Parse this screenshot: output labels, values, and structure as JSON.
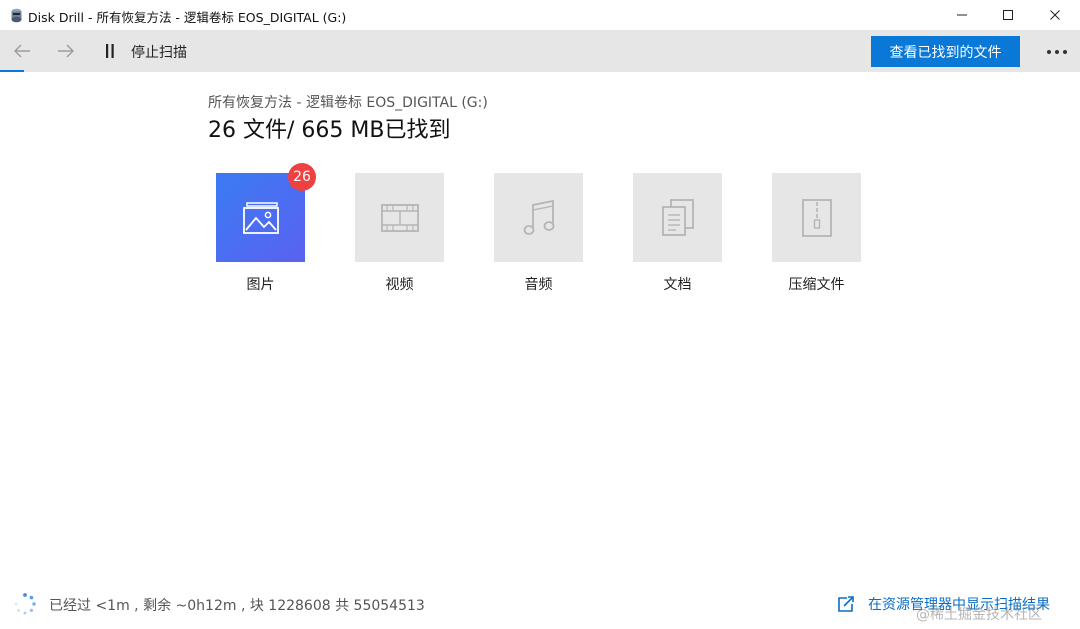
{
  "window": {
    "title": "Disk Drill - 所有恢复方法 - 逻辑卷标 EOS_DIGITAL (G:)",
    "controls": [
      "minimize-icon",
      "maximize-icon",
      "close-icon"
    ]
  },
  "toolbar": {
    "back_icon": "arrow-left-icon",
    "forward_icon": "arrow-right-icon",
    "pause_icon": "pause-icon",
    "pause_label": "停止扫描",
    "primary_label": "查看已找到的文件",
    "more_icon": "more-dots-icon",
    "accent_color": "#0a78d7"
  },
  "scan": {
    "path": "所有恢复方法 - 逻辑卷标 EOS_DIGITAL (G:)",
    "summary": "26 文件/ 665 MB已找到"
  },
  "categories": [
    {
      "label": "图片",
      "icon": "image-icon",
      "badge": "26",
      "active": true
    },
    {
      "label": "视频",
      "icon": "film-icon",
      "active": false
    },
    {
      "label": "音频",
      "icon": "music-note-icon",
      "active": false
    },
    {
      "label": "文档",
      "icon": "documents-icon",
      "active": false
    },
    {
      "label": "压缩文件",
      "icon": "archive-zip-icon",
      "active": false
    }
  ],
  "status": {
    "spinner_icon": "loading-spinner-icon",
    "text": "已经过 <1m , 剩余 ~0h12m , 块 1228608 共 55054513",
    "explorer_icon": "open-external-icon",
    "explorer_label": "在资源管理器中显示扫描结果"
  },
  "watermark": "@稀土掘金技术社区",
  "colors": {
    "badge": "#ef4141",
    "active_tile_start": "#3b7bf3",
    "active_tile_end": "#5a62f0",
    "inactive_tile": "#e6e6e6",
    "link": "#0a6ec4"
  }
}
